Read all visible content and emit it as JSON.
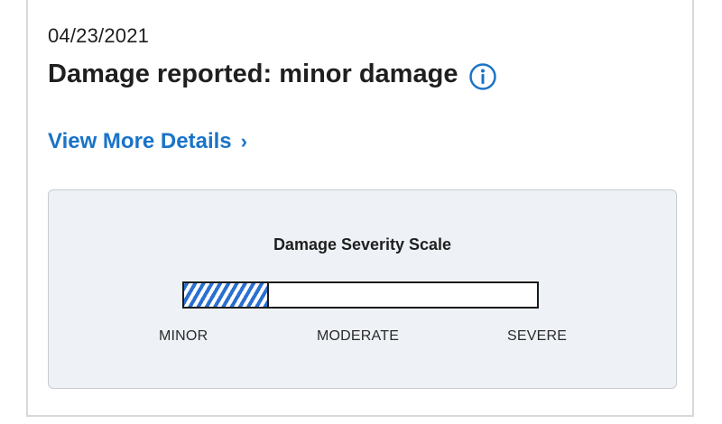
{
  "report": {
    "date": "04/23/2021",
    "headline": "Damage reported: minor damage",
    "info_icon": "info-circle-icon",
    "details_link": "View More Details",
    "details_chevron": "›"
  },
  "severity_scale": {
    "title": "Damage Severity Scale",
    "level_fraction": 0.24,
    "labels": [
      "MINOR",
      "MODERATE",
      "SEVERE"
    ],
    "fill_color": "#2a6fd1"
  },
  "colors": {
    "accent": "#1a73c8"
  }
}
